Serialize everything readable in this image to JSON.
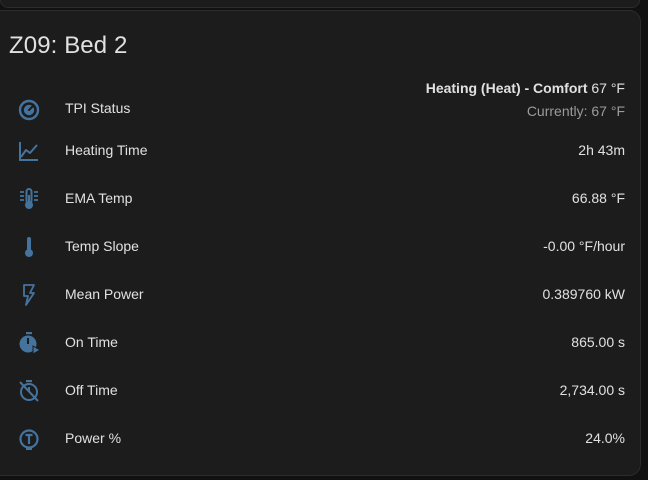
{
  "card": {
    "title": "Z09: Bed 2",
    "tpi": {
      "label": "TPI Status",
      "status_bold": "Heating (Heat) - Comfort",
      "status_temp": "67 °F",
      "current": "Currently: 67 °F",
      "icon": "thermostat-dial-icon"
    },
    "rows": [
      {
        "label": "Heating Time",
        "value": "2h 43m",
        "icon": "chart-line-icon"
      },
      {
        "label": "EMA Temp",
        "value": "66.88 °F",
        "icon": "thermometer-lines-icon"
      },
      {
        "label": "Temp Slope",
        "value": "-0.00 °F/hour",
        "icon": "thermometer-icon"
      },
      {
        "label": "Mean Power",
        "value": "0.389760 kW",
        "icon": "flash-outline-icon"
      },
      {
        "label": "On Time",
        "value": "865.00 s",
        "icon": "timer-play-icon"
      },
      {
        "label": "Off Time",
        "value": "2,734.00 s",
        "icon": "timer-off-icon"
      },
      {
        "label": "Power %",
        "value": "24.0%",
        "icon": "percent-dial-icon"
      }
    ]
  },
  "colors": {
    "icon": "#44739e",
    "background": "#111111",
    "card": "#1c1c1c",
    "text": "#e1e1e1",
    "secondary_text": "#9b9b9b"
  }
}
